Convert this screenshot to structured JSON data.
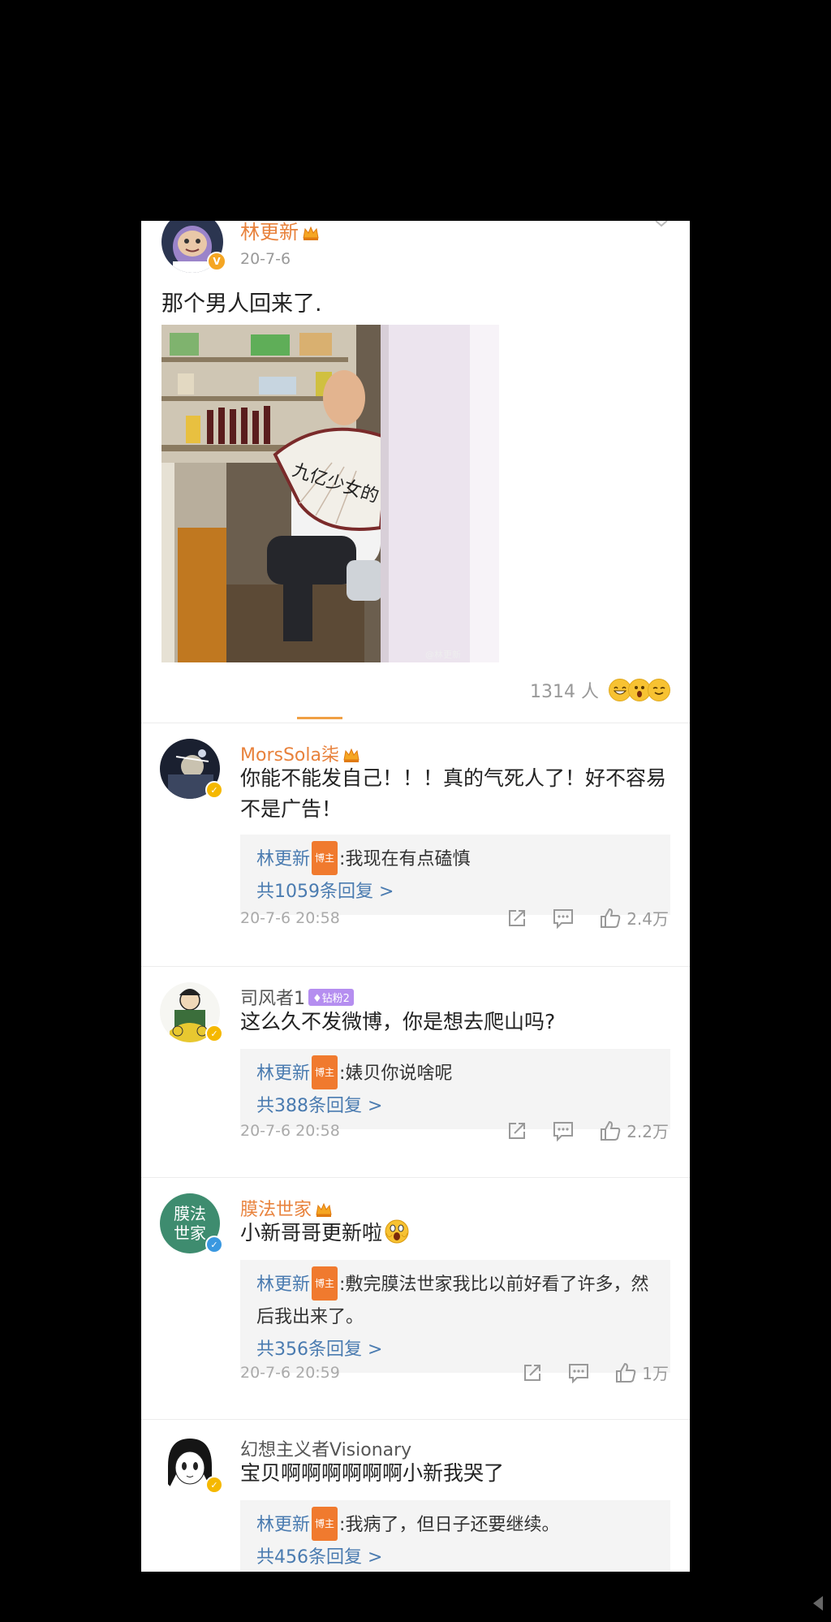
{
  "post": {
    "author": "林更新",
    "date": "20-7-6",
    "text": "那个男人回来了.",
    "photo": {
      "fan_text": "九亿少女的梦",
      "watermark": "@林更新"
    },
    "likes": "1314 人",
    "reaction_emojis": [
      "grinning-face",
      "astonished-face",
      "smiling-face"
    ]
  },
  "comments": [
    {
      "name": "MorsSola柒",
      "text": "你能不能发自己！！！真的气死人了！好不容易不是广告！",
      "reply_author": "林更新",
      "host_tag": "博主",
      "reply_text": ":我现在有点磕慎",
      "reply_more": "共1059条回复 >",
      "time": "20-7-6 20:58",
      "likes": "2.4万"
    },
    {
      "name": "司风者1",
      "fan_badge": "钻粉2",
      "text": "这么久不发微博，你是想去爬山吗?",
      "reply_author": "林更新",
      "host_tag": "博主",
      "reply_text": ":婊贝你说啥呢",
      "reply_more": "共388条回复 >",
      "time": "20-7-6 20:58",
      "likes": "2.2万"
    },
    {
      "name": "膜法世家",
      "avatar_text": "膜法世家",
      "text": "小新哥哥更新啦",
      "reply_author": "林更新",
      "host_tag": "博主",
      "reply_text": ":敷完膜法世家我比以前好看了许多，然后我出来了。",
      "reply_more": "共356条回复 >",
      "time": "20-7-6 20:59",
      "likes": "1万"
    },
    {
      "name": "幻想主义者Visionary",
      "text": "宝贝啊啊啊啊啊啊小新我哭了",
      "reply_author": "林更新",
      "host_tag": "博主",
      "reply_text": ":我病了，但日子还要继续。",
      "reply_more": "共456条回复 >"
    }
  ],
  "colors": {
    "accent_orange": "#e8823c",
    "link_blue": "#4a7bb0",
    "host_tag": "#f07a2e",
    "fan_badge": "#b58ef0",
    "brand_green": "#3e8c6f"
  }
}
